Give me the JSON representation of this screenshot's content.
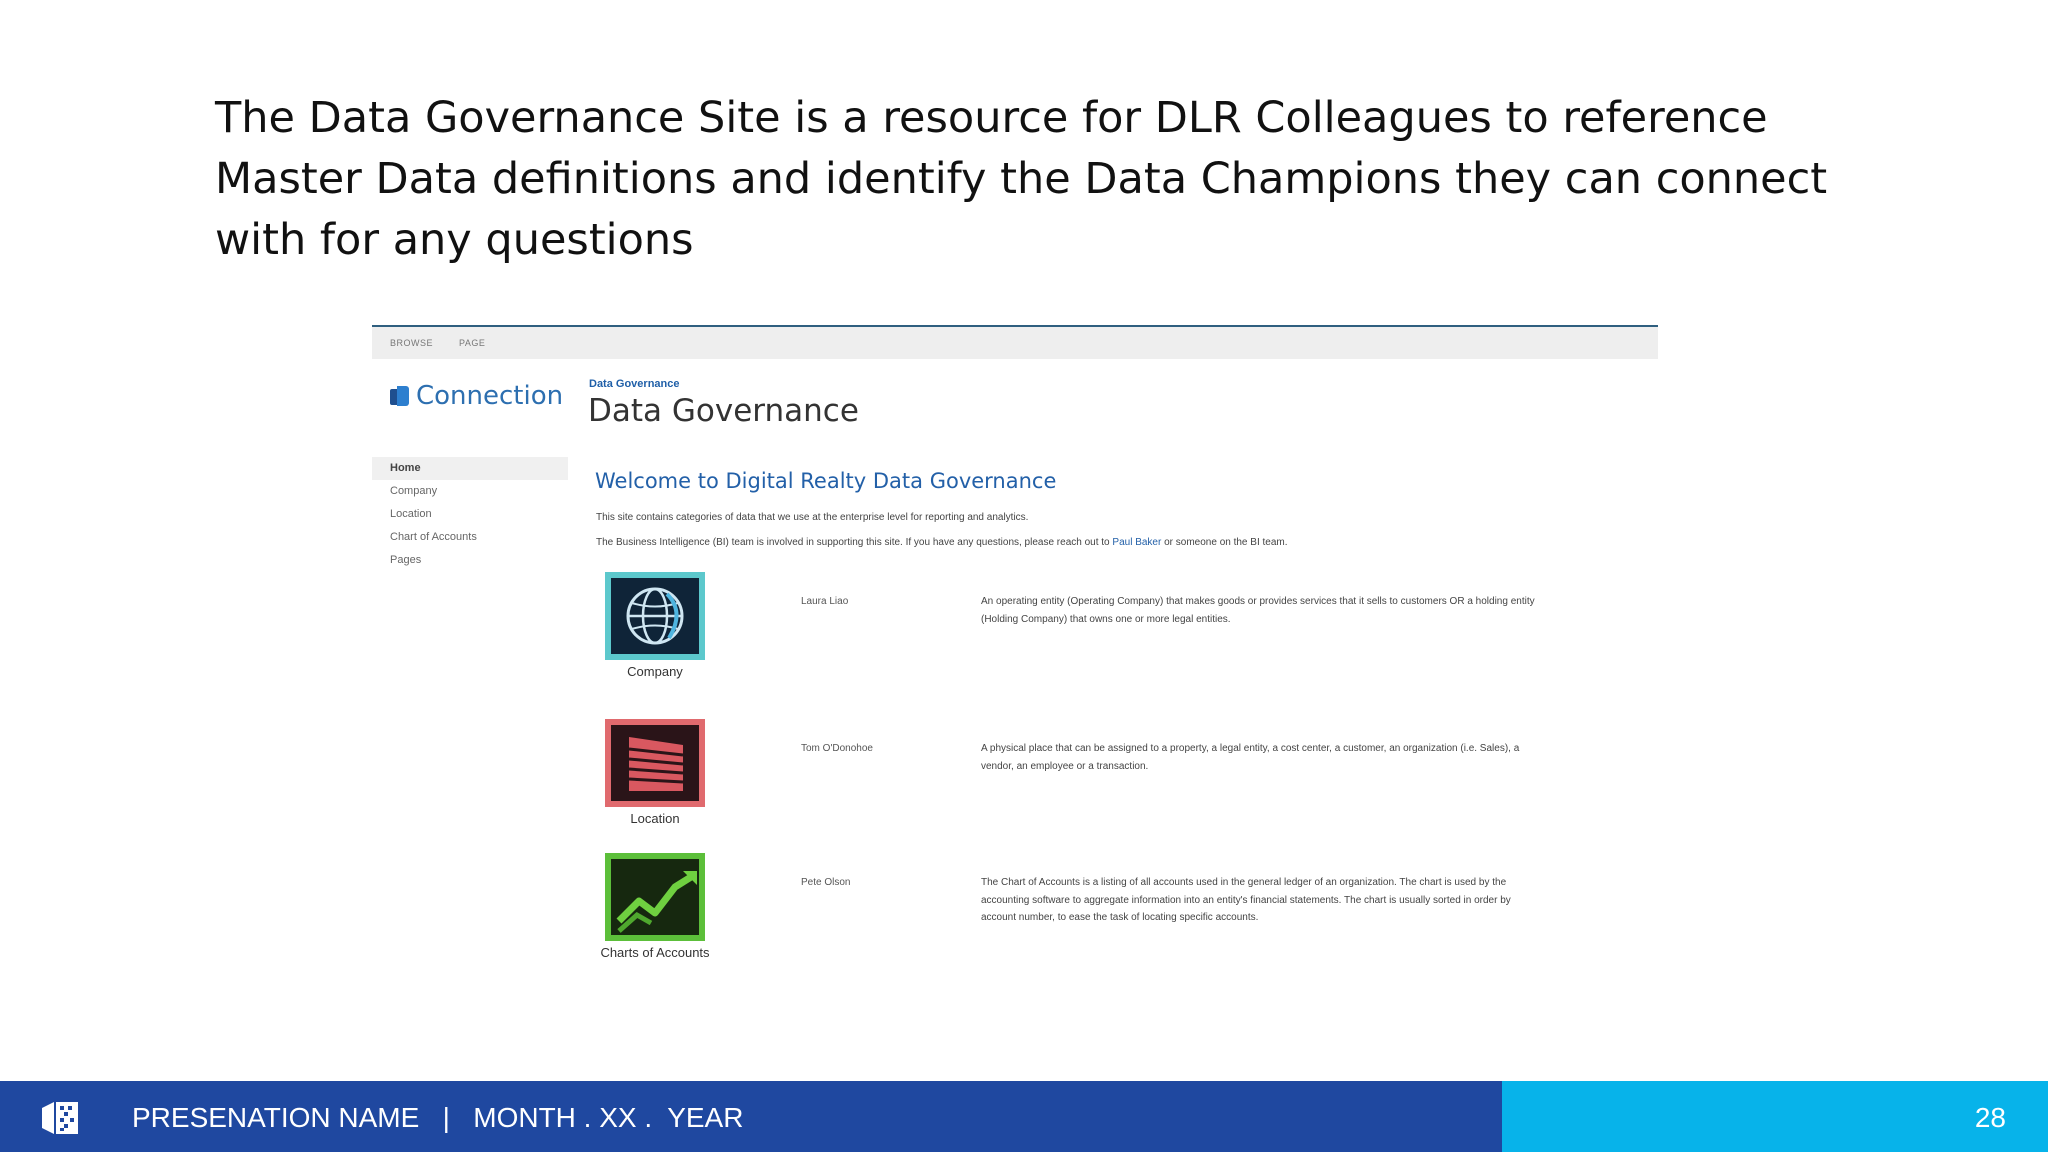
{
  "slide": {
    "heading": "The Data Governance Site is a resource for DLR Colleagues to reference Master Data definitions and identify the Data Champions they can connect with for any questions"
  },
  "screenshot": {
    "topbar": [
      "BROWSE",
      "PAGE"
    ],
    "brand": "Connection",
    "site_subtitle": "Data Governance",
    "site_title": "Data Governance",
    "nav": [
      "Home",
      "Company",
      "Location",
      "Chart of Accounts",
      "Pages"
    ],
    "welcome": "Welcome to Digital Realty Data Governance",
    "intro_1": "This site contains categories of data that we use at the enterprise level for reporting and analytics.",
    "intro_2_pre": "The Business Intelligence (BI) team is involved in supporting this site. If you have any questions, please reach out to ",
    "intro_2_link": "Paul Baker",
    "intro_2_post": " or someone on the BI team.",
    "rows": [
      {
        "caption": "Company",
        "champion": "Laura Liao",
        "description": "An operating entity (Operating Company) that makes goods or provides services that it sells to customers OR a holding entity (Holding Company) that owns one or more legal entities.",
        "tile_color": "#5cc8cc",
        "icon": "globe-icon"
      },
      {
        "caption": "Location",
        "champion": "Tom O'Donohoe",
        "description": "A physical place that can be assigned to a property, a legal entity, a cost center, a customer, an organization (i.e. Sales), a vendor, an employee or a transaction.",
        "tile_color": "#e06a6e",
        "icon": "building-icon"
      },
      {
        "caption": "Charts of Accounts",
        "champion": "Pete Olson",
        "description": "The Chart of Accounts is a listing of all accounts used in the general ledger of an organization. The chart is used by the accounting software to aggregate information into an entity's financial statements. The chart is usually sorted in order by account number, to ease the task of locating specific accounts.",
        "tile_color": "#5cbf3a",
        "icon": "trend-chart-icon"
      }
    ]
  },
  "footer": {
    "text": "PRESENATION NAME   |   MONTH . XX .  YEAR",
    "page_number": "28",
    "left_color": "#1f48a0",
    "right_color": "#07b3ea"
  }
}
